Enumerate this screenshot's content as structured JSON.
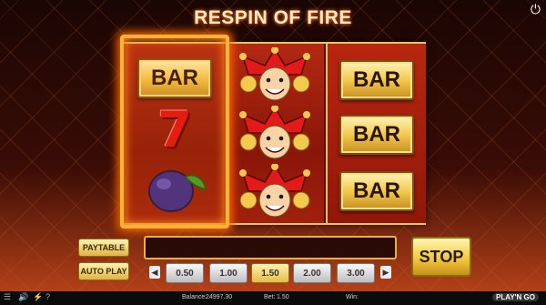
{
  "title": "RESPIN OF FIRE",
  "reels": [
    [
      "BAR",
      "7",
      "plum"
    ],
    [
      "jester",
      "jester",
      "jester"
    ],
    [
      "BAR",
      "BAR",
      "BAR"
    ]
  ],
  "controls": {
    "paytable": "PAYTABLE",
    "autoplay": "AUTO PLAY",
    "stop": "STOP"
  },
  "bets": {
    "options": [
      "0.50",
      "1.00",
      "1.50",
      "2.00",
      "3.00"
    ],
    "selected": "1.50"
  },
  "status": {
    "balance_label": "Balance:",
    "balance_value": "24997.30",
    "bet_label": "Bet:",
    "bet_value": "1.50",
    "win_label": "Win:",
    "win_value": "",
    "brand": "PLAY'N GO"
  },
  "colors": {
    "accent_gold": "#e7c46a",
    "fire": "#ff6a00",
    "reel_red": "#a0200c"
  }
}
